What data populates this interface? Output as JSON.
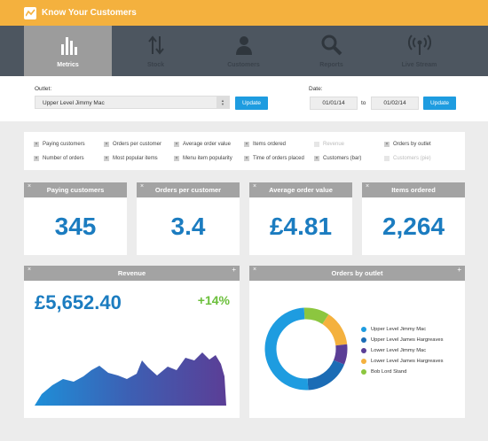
{
  "app": {
    "title": "Know Your Customers"
  },
  "nav": [
    {
      "label": "Metrics",
      "icon": "bar-chart-icon",
      "active": true
    },
    {
      "label": "Stock",
      "icon": "arrows-updown-icon",
      "active": false
    },
    {
      "label": "Customers",
      "icon": "person-icon",
      "active": false
    },
    {
      "label": "Reports",
      "icon": "magnifier-icon",
      "active": false
    },
    {
      "label": "Live Stream",
      "icon": "broadcast-icon",
      "active": false
    }
  ],
  "filters": {
    "outlet_label": "Outlet:",
    "outlet_value": "Upper Level Jimmy Mac",
    "update_label": "Update",
    "date_label": "Date:",
    "date_from": "01/01/14",
    "date_to_label": "to",
    "date_to": "01/02/14",
    "update2_label": "Update"
  },
  "checkboxes": [
    {
      "label": "Paying customers",
      "checked": true
    },
    {
      "label": "Orders per customer",
      "checked": true
    },
    {
      "label": "Average order value",
      "checked": true
    },
    {
      "label": "Items ordered",
      "checked": true
    },
    {
      "label": "Revenue",
      "checked": false
    },
    {
      "label": "Orders by outlet",
      "checked": true
    },
    {
      "label": "Number of orders",
      "checked": true
    },
    {
      "label": "Most popular items",
      "checked": true
    },
    {
      "label": "Menu item popularity",
      "checked": true
    },
    {
      "label": "Time of orders placed",
      "checked": true
    },
    {
      "label": "Customers (bar)",
      "checked": true
    },
    {
      "label": "Customers (pie)",
      "checked": false
    }
  ],
  "metrics": [
    {
      "title": "Paying customers",
      "value": "345"
    },
    {
      "title": "Orders per customer",
      "value": "3.4"
    },
    {
      "title": "Average order value",
      "value": "£4.81"
    },
    {
      "title": "Items ordered",
      "value": "2,264"
    }
  ],
  "revenue": {
    "title": "Revenue",
    "value": "£5,652.40",
    "change": "+14%"
  },
  "outlets": {
    "title": "Orders by outlet",
    "items": [
      {
        "label": "Upper Level Jimmy Mac",
        "color": "#1e9ce0",
        "share": 0.5
      },
      {
        "label": "Upper Level James Hargreaves",
        "color": "#1b6cb5",
        "share": 0.18
      },
      {
        "label": "Lower Level Jimmy Mac",
        "color": "#5b3e96",
        "share": 0.08
      },
      {
        "label": "Lower Level James Hargreaves",
        "color": "#f4b13e",
        "share": 0.14
      },
      {
        "label": "Bob Lord Stand",
        "color": "#8cc63f",
        "share": 0.1
      }
    ]
  },
  "card_controls": {
    "close": "×",
    "expand": "+"
  }
}
